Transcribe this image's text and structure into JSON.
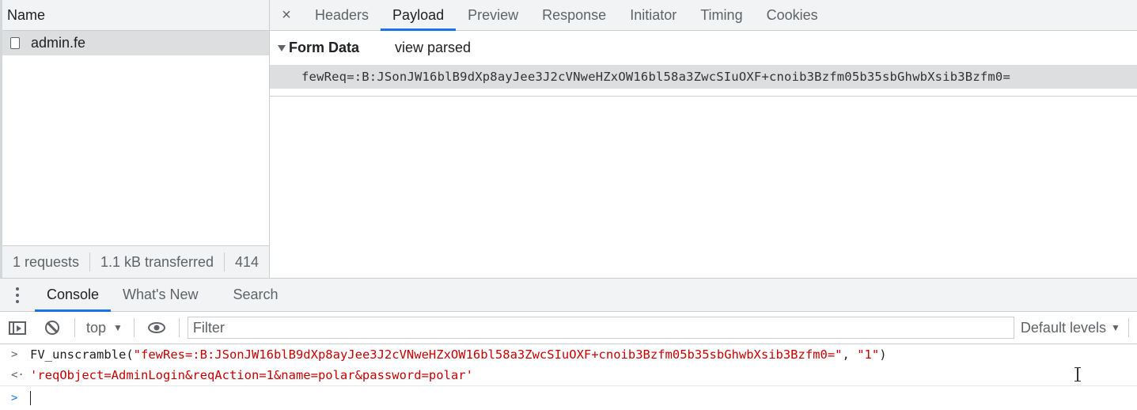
{
  "network": {
    "name_header": "Name",
    "requests": [
      {
        "name": "admin.fe",
        "icon": "document-icon"
      }
    ],
    "status": {
      "requests": "1 requests",
      "transferred": "1.1 kB transferred",
      "resources": "414"
    }
  },
  "detail": {
    "close_icon": "×",
    "tabs": [
      "Headers",
      "Payload",
      "Preview",
      "Response",
      "Initiator",
      "Timing",
      "Cookies"
    ],
    "active_tab": "Payload",
    "form_data_title": "Form Data",
    "view_parsed": "view parsed",
    "form_row": "fewReq=:B:JSonJW16blB9dXp8ayJee3J2cVNweHZxOW16bl58a3ZwcSIuOXF+cnoib3Bzfm05b35sbGhwbXsib3Bzfm0="
  },
  "drawer": {
    "tabs": [
      "Console",
      "What's New",
      "Search"
    ],
    "active_tab": "Console",
    "toolbar": {
      "context": "top",
      "filter_placeholder": "Filter",
      "levels": "Default levels"
    },
    "console": {
      "input_fn": "FV_unscramble(",
      "input_arg1": "\"fewRes=:B:JSonJW16blB9dXp8ayJee3J2cVNweHZxOW16bl58a3ZwcSIuOXF+cnoib3Bzfm05b35sbGhwbXsib3Bzfm0=\"",
      "input_sep": ", ",
      "input_arg2": "\"1\"",
      "input_close": ")",
      "result": "'reqObject=AdminLogin&reqAction=1&name=polar&password=polar'"
    }
  },
  "colors": {
    "accent": "#1a73e8",
    "string": "#c80000",
    "panel_bg": "#f1f3f4",
    "selected_row": "#dcdedf"
  }
}
